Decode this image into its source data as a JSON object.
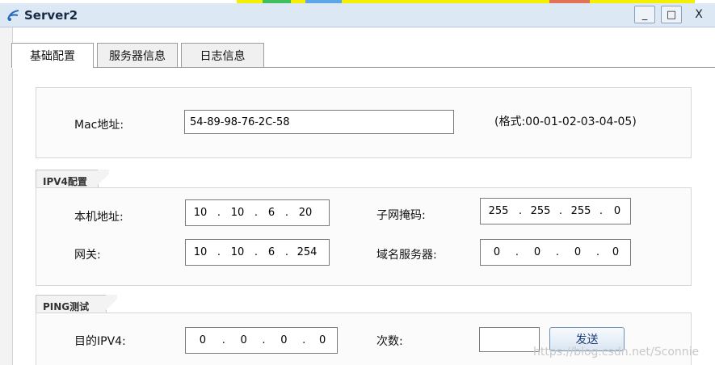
{
  "window": {
    "title": "Server2",
    "minimize": "_",
    "maximize": "□",
    "close": "X"
  },
  "tabs": [
    {
      "label": "基础配置",
      "active": true
    },
    {
      "label": "服务器信息",
      "active": false
    },
    {
      "label": "日志信息",
      "active": false
    }
  ],
  "mac": {
    "label": "Mac地址:",
    "value": "54-89-98-76-2C-58",
    "hint": "(格式:00-01-02-03-04-05)"
  },
  "ipv4": {
    "section_title": "IPV4配置",
    "host_label": "本机地址:",
    "host": [
      "10",
      "10",
      "6",
      "20"
    ],
    "mask_label": "子网掩码:",
    "mask": [
      "255",
      "255",
      "255",
      "0"
    ],
    "gateway_label": "网关:",
    "gateway": [
      "10",
      "10",
      "6",
      "254"
    ],
    "dns_label": "域名服务器:",
    "dns": [
      "0",
      "0",
      "0",
      "0"
    ]
  },
  "ping": {
    "section_title": "PING测试",
    "dest_label": "目的IPV4:",
    "dest": [
      "0",
      "0",
      "0",
      "0"
    ],
    "count_label": "次数:",
    "count_value": "",
    "send_label": "发送"
  },
  "watermark": "https://blog.csdn.net/Sconnie",
  "colors": {
    "titlebar": "#dde8f5",
    "accent_button_text": "#1f3d7a"
  }
}
